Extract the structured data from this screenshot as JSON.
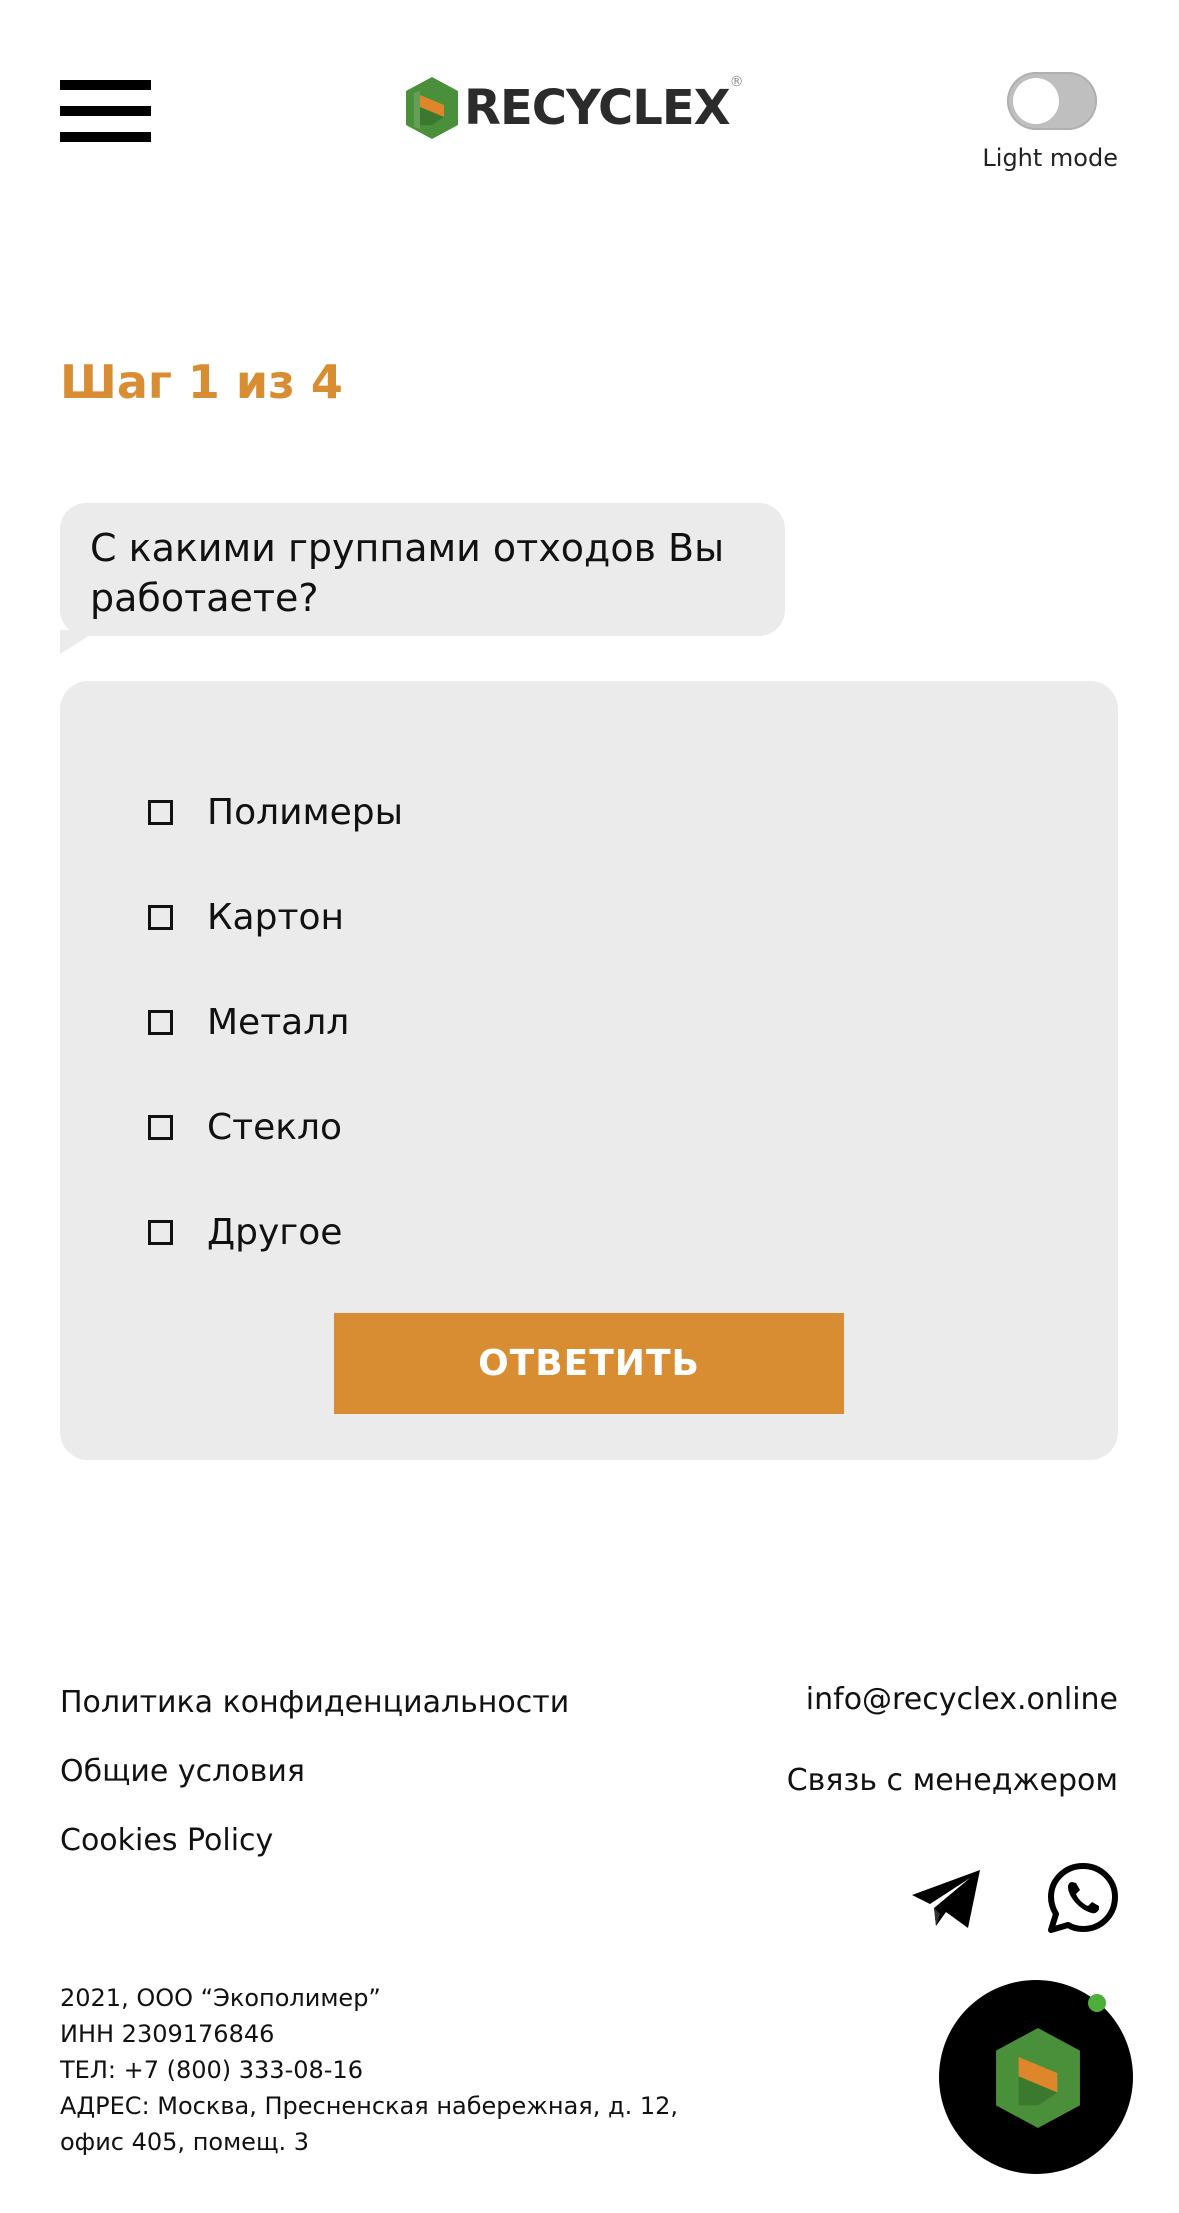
{
  "header": {
    "logo_text": "RECYCLEX",
    "logo_reg": "®",
    "theme_label": "Light mode"
  },
  "step": {
    "label": "Шаг 1 из 4"
  },
  "question": {
    "text": "С какими группами отходов Вы работаете?"
  },
  "options": [
    {
      "label": "Полимеры",
      "checked": false
    },
    {
      "label": "Картон",
      "checked": false
    },
    {
      "label": "Металл",
      "checked": false
    },
    {
      "label": "Стекло",
      "checked": false
    },
    {
      "label": "Другое",
      "checked": false
    }
  ],
  "answer_button": {
    "label": "ОТВЕТИТЬ"
  },
  "footer": {
    "links": [
      "Политика конфиденциальности",
      "Общие условия",
      "Cookies Policy"
    ],
    "email": "info@recyclex.online",
    "manager": "Связь с менеджером",
    "icons": [
      "telegram-icon",
      "whatsapp-icon"
    ],
    "legal": [
      "2021, ООО “Экополимер”",
      "ИНН 2309176846",
      "ТЕЛ: +7 (800) 333-08-16",
      "АДРЕС: Москва, Пресненская набережная, д. 12,",
      "офис 405, помещ. 3"
    ]
  },
  "colors": {
    "accent": "#d98d33",
    "panel": "#ebebeb",
    "logo_green": "#4a8f3a",
    "logo_orange": "#e0862a",
    "status_dot": "#4caf3a"
  }
}
